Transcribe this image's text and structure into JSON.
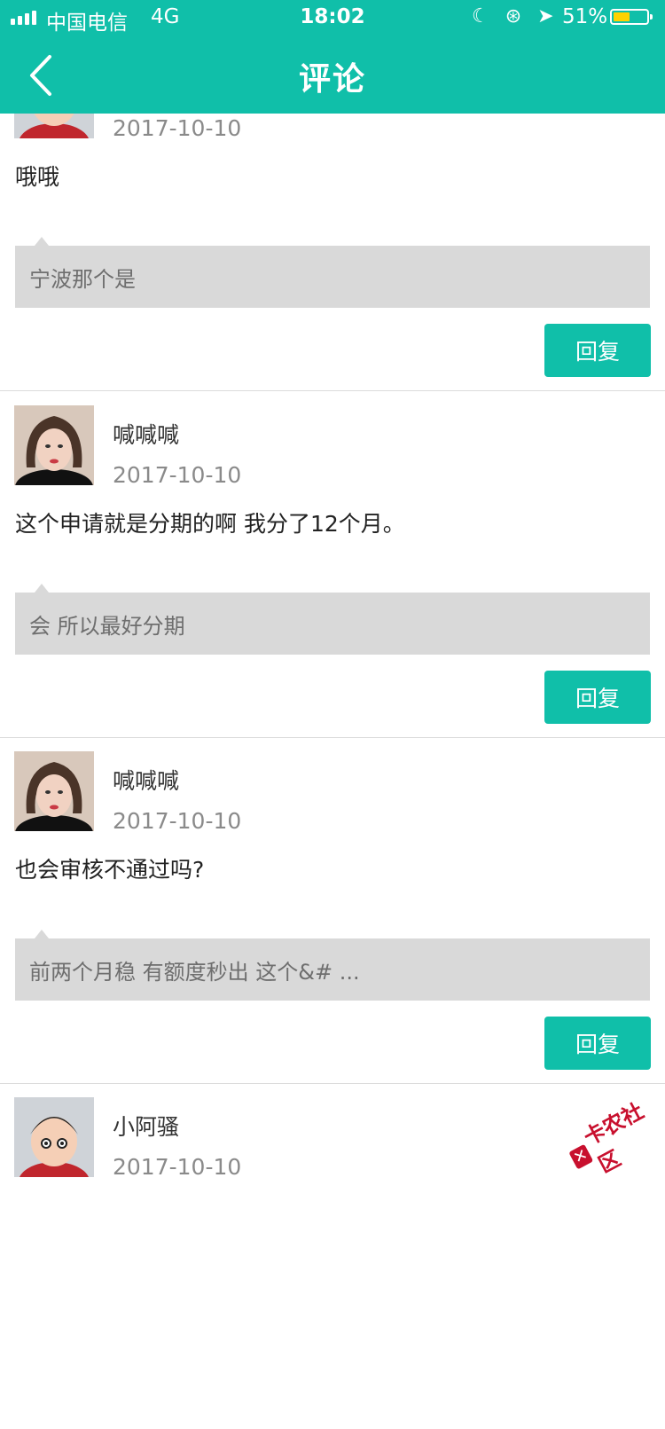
{
  "status": {
    "carrier": "中国电信",
    "network": "4G",
    "time": "18:02",
    "battery": "51%",
    "battery_level": 0.51
  },
  "nav": {
    "title": "评论"
  },
  "comments": [
    {
      "name": "",
      "date": "2017-10-10",
      "body": "哦哦",
      "reply": "宁波那个是",
      "button": "回复"
    },
    {
      "name": "喊喊喊",
      "date": "2017-10-10",
      "body": "这个申请就是分期的啊 我分了12个月。",
      "reply": "会 所以最好分期",
      "button": "回复"
    },
    {
      "name": "喊喊喊",
      "date": "2017-10-10",
      "body": "也会审核不通过吗?",
      "reply": "前两个月稳 有额度秒出 这个&# ...",
      "button": "回复"
    },
    {
      "name": "小阿骚",
      "date": "2017-10-10",
      "body": "",
      "reply": "",
      "button": ""
    }
  ],
  "watermark": {
    "text": "卡农社区"
  },
  "colors": {
    "accent": "#10bfa9",
    "reply_bg": "#d9d9d9"
  }
}
